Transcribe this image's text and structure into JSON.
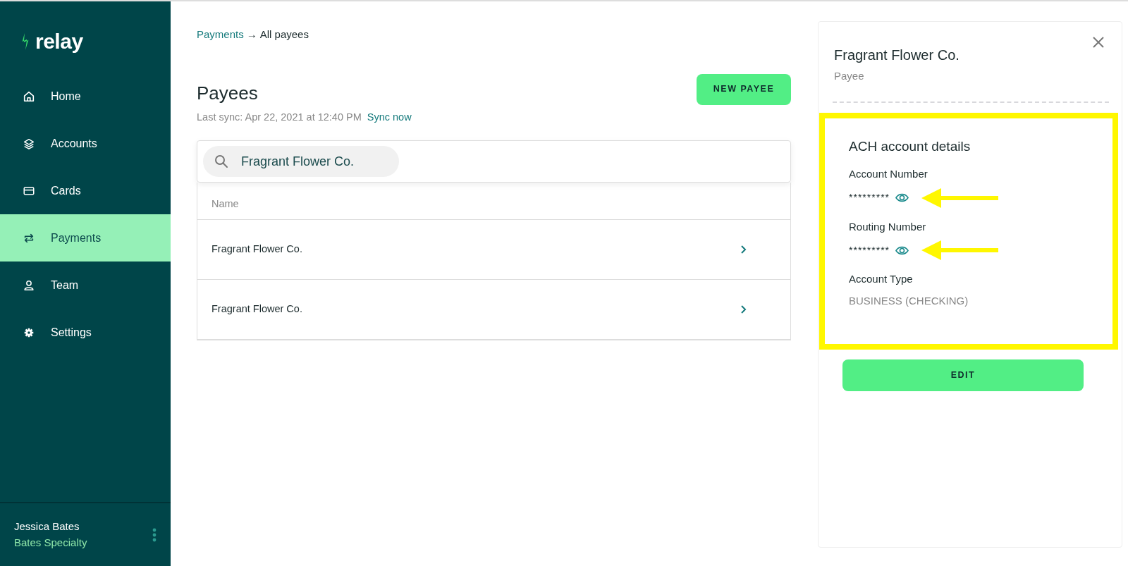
{
  "sidebar": {
    "logo": "relay",
    "items": [
      {
        "label": "Home",
        "selected": false
      },
      {
        "label": "Accounts",
        "selected": false
      },
      {
        "label": "Cards",
        "selected": false
      },
      {
        "label": "Payments",
        "selected": true
      },
      {
        "label": "Team",
        "selected": false
      },
      {
        "label": "Settings",
        "selected": false
      }
    ],
    "user": {
      "name": "Jessica Bates",
      "company": "Bates Specialty"
    }
  },
  "breadcrumb": {
    "parent": "Payments",
    "separator": "→",
    "current": "All payees"
  },
  "page": {
    "title": "Payees",
    "last_sync": "Last sync: Apr 22, 2021 at 12:40 PM",
    "sync_link": "Sync now",
    "new_button": "NEW PAYEE"
  },
  "search": {
    "value": "Fragrant Flower Co."
  },
  "table": {
    "columns": [
      "Name"
    ],
    "rows": [
      {
        "name": "Fragrant Flower Co."
      },
      {
        "name": "Fragrant Flower Co."
      }
    ]
  },
  "detail": {
    "title": "Fragrant Flower Co.",
    "subtitle": "Payee",
    "section": {
      "title": "ACH account details",
      "highlighted": true,
      "fields": [
        {
          "label": "Account Number",
          "value": "*********",
          "kind": "masked",
          "pointed": true
        },
        {
          "label": "Routing Number",
          "value": "*********",
          "kind": "masked",
          "pointed": true
        },
        {
          "label": "Account Type",
          "value": "BUSINESS (CHECKING)",
          "kind": "plain",
          "pointed": false
        }
      ]
    },
    "edit_button": "EDIT"
  }
}
